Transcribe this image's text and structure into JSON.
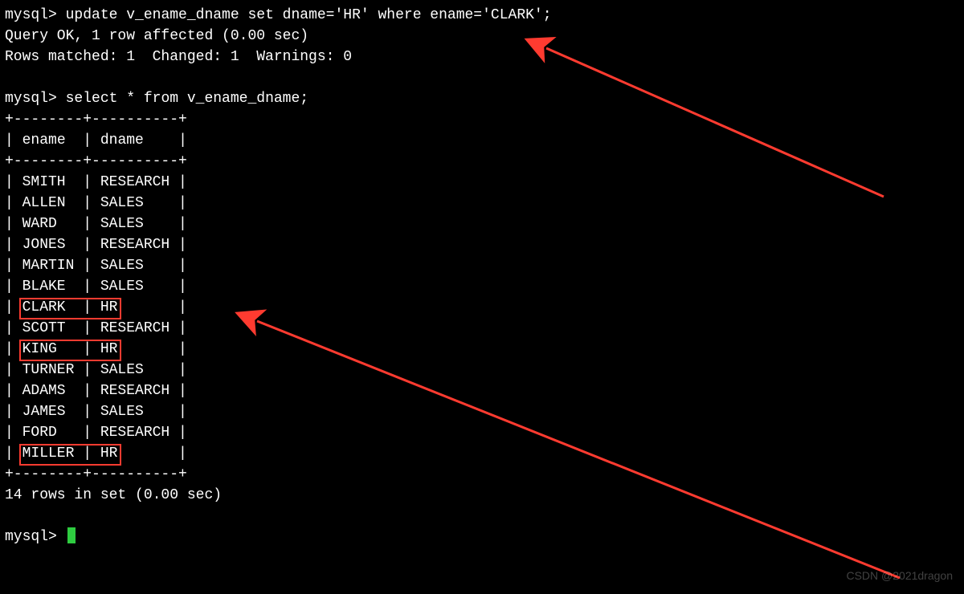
{
  "prompt": "mysql>",
  "cmd_update": "update v_ename_dname set dname='HR' where ename='CLARK';",
  "result_ok": "Query OK, 1 row affected (0.00 sec)",
  "result_rows": "Rows matched: 1  Changed: 1  Warnings: 0",
  "cmd_select": "select * from v_ename_dname;",
  "border": "+--------+----------+",
  "header_ename": "ename",
  "header_dname": "dname",
  "rows": [
    {
      "ename": "SMITH",
      "dname": "RESEARCH"
    },
    {
      "ename": "ALLEN",
      "dname": "SALES"
    },
    {
      "ename": "WARD",
      "dname": "SALES"
    },
    {
      "ename": "JONES",
      "dname": "RESEARCH"
    },
    {
      "ename": "MARTIN",
      "dname": "SALES"
    },
    {
      "ename": "BLAKE",
      "dname": "SALES"
    },
    {
      "ename": "CLARK",
      "dname": "HR"
    },
    {
      "ename": "SCOTT",
      "dname": "RESEARCH"
    },
    {
      "ename": "KING",
      "dname": "HR"
    },
    {
      "ename": "TURNER",
      "dname": "SALES"
    },
    {
      "ename": "ADAMS",
      "dname": "RESEARCH"
    },
    {
      "ename": "JAMES",
      "dname": "SALES"
    },
    {
      "ename": "FORD",
      "dname": "RESEARCH"
    },
    {
      "ename": "MILLER",
      "dname": "HR"
    }
  ],
  "summary": "14 rows in set (0.00 sec)",
  "watermark": "CSDN @2021dragon",
  "highlights": [
    {
      "row": 6
    },
    {
      "row": 8
    },
    {
      "row": 13
    }
  ],
  "annotations": {
    "highlight_color": "#ff3b30"
  }
}
